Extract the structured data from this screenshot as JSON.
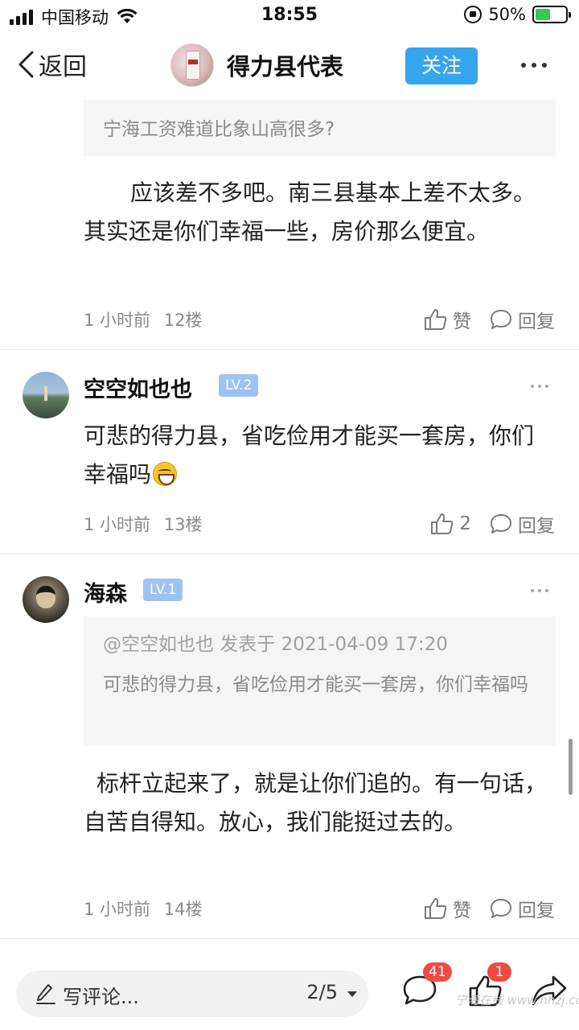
{
  "status_bar": {
    "carrier": "中国移动",
    "time": "18:55",
    "battery": "50%",
    "battery_level": 0.5
  },
  "nav": {
    "back_label": "返回",
    "title": "得力县代表",
    "follow_label": "关注"
  },
  "post_12": {
    "quote": "宁海工资难道比象山高很多?",
    "body": "应该差不多吧。南三县基本上差不太多。其实还是你们幸福一些，房价那么便宜。",
    "time": "1 小时前",
    "floor": "12楼",
    "like_label": "赞",
    "reply_label": "回复"
  },
  "post_13": {
    "username": "空空如也也",
    "level": "LV.2",
    "body": "可悲的得力县，省吃俭用才能买一套房，你们幸福吗",
    "emoji": "laughing-tears",
    "time": "1 小时前",
    "floor": "13楼",
    "like_count": "2",
    "reply_label": "回复"
  },
  "post_14": {
    "username": "海森",
    "level": "LV.1",
    "quote_header": "@空空如也也 发表于 2021-04-09 17:20",
    "quote_body": "可悲的得力县，省吃俭用才能买一套房，你们幸福吗",
    "body": "标杆立起来了，就是让你们追的。有一句话，自苦自得知。放心，我们能挺过去的。",
    "time": "1 小时前",
    "floor": "14楼",
    "like_label": "赞",
    "reply_label": "回复"
  },
  "bottom_bar": {
    "comment_placeholder": "写评论...",
    "page_indicator": "2/5",
    "comment_count": "41",
    "like_count": "1"
  },
  "watermark": "宁海在线 www.nhzj.com",
  "colors": {
    "accent": "#35a6ee",
    "badge": "#f04a43",
    "level_badge": "#9ec3f2",
    "meta_gray": "#8a8a8a"
  }
}
